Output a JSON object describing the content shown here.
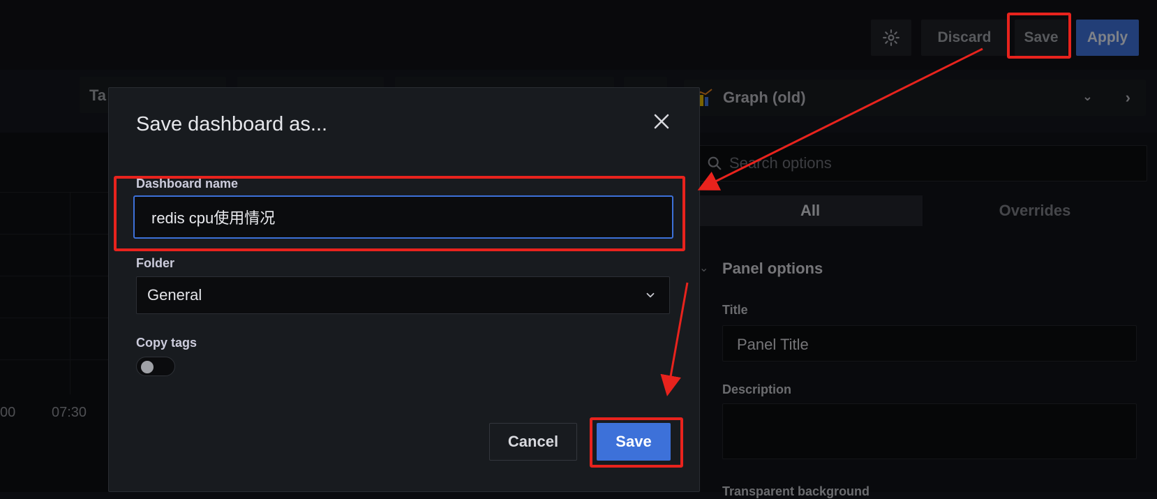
{
  "header": {
    "settings_icon": "gear-icon",
    "discard_label": "Discard",
    "save_label": "Save",
    "apply_label": "Apply"
  },
  "editor": {
    "partial_tab_label": "Ta",
    "visualization": {
      "icon": "graph-icon",
      "label": "Graph (old)"
    },
    "search": {
      "placeholder": "Search options"
    },
    "tabs": [
      "All",
      "Overrides"
    ],
    "panel_options": {
      "section_title": "Panel options",
      "title_label": "Title",
      "title_value": "Panel Title",
      "description_label": "Description",
      "next_label_partial": "Transparent background"
    }
  },
  "graph": {
    "x_ticks": [
      "00",
      "07:30"
    ]
  },
  "modal": {
    "title": "Save dashboard as...",
    "dashboard_name_label": "Dashboard name",
    "dashboard_name_value": "redis cpu使用情况",
    "folder_label": "Folder",
    "folder_value": "General",
    "copy_tags_label": "Copy tags",
    "copy_tags_enabled": false,
    "cancel_label": "Cancel",
    "save_label": "Save"
  },
  "colors": {
    "accent_blue": "#3d71d9",
    "annotation_red": "#e8231d",
    "modal_bg": "#181b1f"
  }
}
